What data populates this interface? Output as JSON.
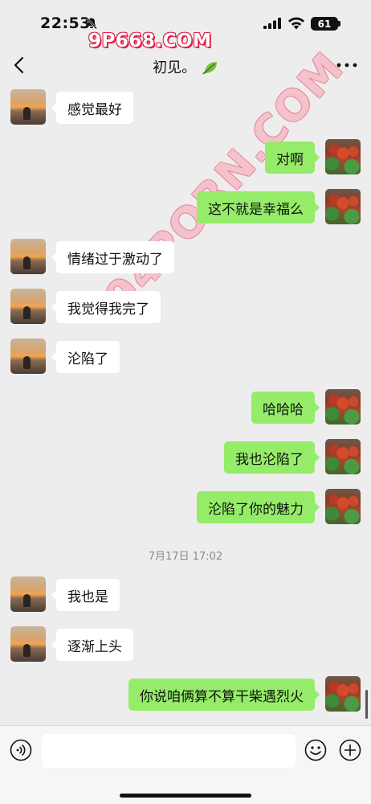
{
  "status_bar": {
    "time": "22:53",
    "battery": "61"
  },
  "watermarks": {
    "top": "9P668.COM",
    "diagonal": "94PORN.COM"
  },
  "header": {
    "title": "初见。"
  },
  "messages": [
    {
      "side": "in",
      "text": "感觉最好"
    },
    {
      "side": "out",
      "text": "对啊"
    },
    {
      "side": "out",
      "text": "这不就是幸福么"
    },
    {
      "side": "in",
      "text": "情绪过于激动了"
    },
    {
      "side": "in",
      "text": "我觉得我完了"
    },
    {
      "side": "in",
      "text": "沦陷了"
    },
    {
      "side": "out",
      "text": "哈哈哈"
    },
    {
      "side": "out",
      "text": "我也沦陷了"
    },
    {
      "side": "out",
      "text": "沦陷了你的魅力"
    },
    {
      "side": "in",
      "text": "我也是"
    },
    {
      "side": "in",
      "text": "逐渐上头"
    },
    {
      "side": "out",
      "text": "你说咱俩算不算干柴遇烈火"
    }
  ],
  "timestamp": "7月17日 17:02",
  "icons": {
    "back": "chevron-left-icon",
    "more": "ellipsis-icon",
    "voice": "voice-icon",
    "emoji": "emoji-icon",
    "add": "plus-icon",
    "leaf": "leaf-icon",
    "bell": "bell-slash-icon"
  },
  "colors": {
    "outgoing_bubble": "#95ec69",
    "incoming_bubble": "#ffffff",
    "background": "#ededed",
    "watermark": "#e0224a"
  }
}
